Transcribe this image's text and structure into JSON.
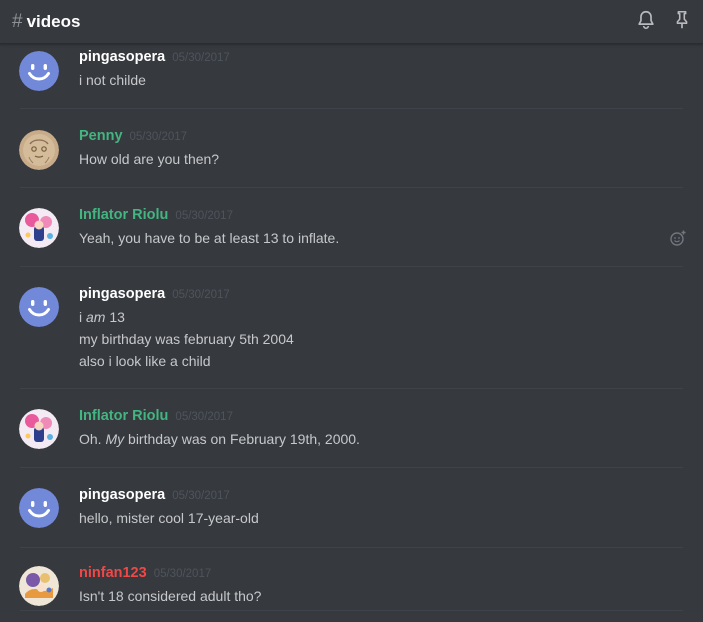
{
  "channel": {
    "hash": "#",
    "name": "videos"
  },
  "header_icons": [
    "bell-icon",
    "pin-icon"
  ],
  "colors": {
    "background": "#36393e",
    "green_author": "#43b581",
    "red_author": "#f04747",
    "white_author": "#ffffff",
    "blurple": "#7289da"
  },
  "messages": [
    {
      "author": "pingasopera",
      "timestamp": "05/30/2017",
      "lines": [
        "i not childe"
      ]
    },
    {
      "author": "Penny",
      "timestamp": "05/30/2017",
      "lines": [
        "How old are you then?"
      ]
    },
    {
      "author": "Inflator Riolu",
      "timestamp": "05/30/2017",
      "lines": [
        "Yeah, you have to be at least 13 to inflate."
      ]
    },
    {
      "author": "pingasopera",
      "timestamp": "05/30/2017",
      "lines": [
        {
          "pre": "i ",
          "em": "am",
          "post": " 13"
        },
        "my birthday was february 5th 2004",
        "also i look like a child"
      ]
    },
    {
      "author": "Inflator Riolu",
      "timestamp": "05/30/2017",
      "lines": [
        {
          "pre": "Oh. ",
          "em": "My",
          "post": " birthday was on February 19th, 2000."
        }
      ]
    },
    {
      "author": "pingasopera",
      "timestamp": "05/30/2017",
      "lines": [
        "hello, mister cool 17-year-old"
      ]
    },
    {
      "author": "ninfan123",
      "timestamp": "05/30/2017",
      "lines": [
        "Isn't 18 considered adult tho?"
      ]
    }
  ]
}
